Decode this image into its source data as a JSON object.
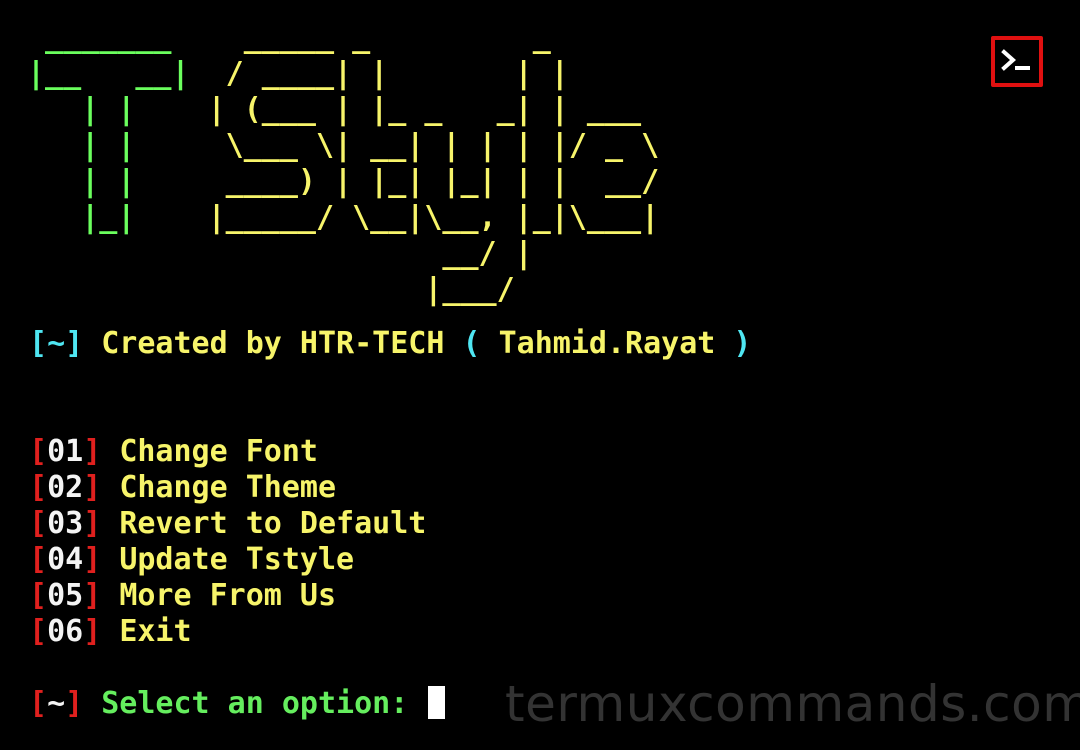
{
  "banner": {
    "t_lines": [
      " _______ ",
      "|__   __|",
      "   | |   ",
      "   | |   ",
      "   | |   ",
      "   |_|   ",
      "         ",
      "         "
    ],
    "style_lines": [
      "   _____ _         _       ",
      "  / ____| |       | |      ",
      " | (___ | |_ _   _| | ___  ",
      "  \\___ \\| __| | | | |/ _ \\ ",
      "  ____) | |_| |_| | |  __/ ",
      " |_____/ \\__|\\__, |_|\\___| ",
      "              __/ |        ",
      "             |___/         "
    ]
  },
  "credit": {
    "open_bracket": "[",
    "tilde": "~",
    "close_bracket": "]",
    "text": " Created by HTR-TECH ",
    "paren_open": "(",
    "name": " Tahmid.Rayat ",
    "paren_close": ")"
  },
  "menu": {
    "items": [
      {
        "num": "01",
        "label": "Change Font"
      },
      {
        "num": "02",
        "label": "Change Theme"
      },
      {
        "num": "03",
        "label": "Revert to Default"
      },
      {
        "num": "04",
        "label": "Update Tstyle"
      },
      {
        "num": "05",
        "label": "More From Us"
      },
      {
        "num": "06",
        "label": "Exit"
      }
    ]
  },
  "prompt": {
    "open_bracket": "[",
    "tilde": "~",
    "close_bracket": "]",
    "text": " Select an option: "
  },
  "watermark": {
    "text": "termuxcommands.com"
  },
  "app_icon": {
    "name": "terminal-icon",
    "border_color": "#e01010"
  },
  "colors": {
    "background": "#000000",
    "banner_t": "#6bff5e",
    "banner_style": "#f7f46a",
    "cyan": "#4fe6f2",
    "yellow": "#f7f46a",
    "red": "#e0201e",
    "green": "#65ee5e"
  }
}
